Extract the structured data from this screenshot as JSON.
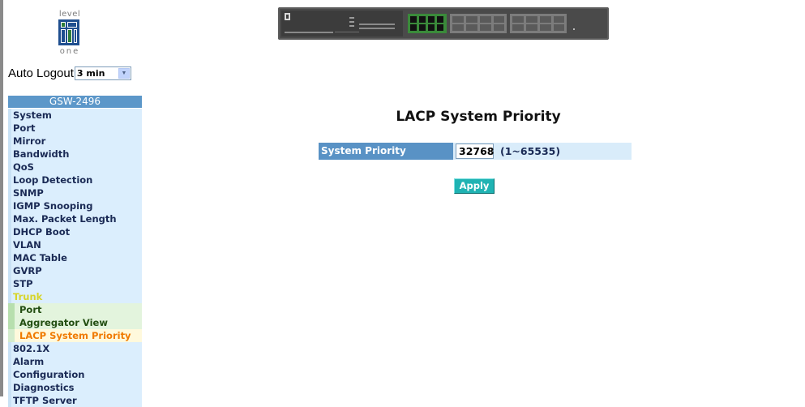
{
  "logo": {
    "top_text": "level",
    "bottom_text": "one"
  },
  "auto_logout": {
    "label": "Auto Logout",
    "selected": "3 min"
  },
  "sidebar": {
    "title": "GSW-2496",
    "items": [
      {
        "label": "System"
      },
      {
        "label": "Port"
      },
      {
        "label": "Mirror"
      },
      {
        "label": "Bandwidth"
      },
      {
        "label": "QoS"
      },
      {
        "label": "Loop Detection"
      },
      {
        "label": "SNMP"
      },
      {
        "label": "IGMP Snooping"
      },
      {
        "label": "Max. Packet Length"
      },
      {
        "label": "DHCP Boot"
      },
      {
        "label": "VLAN"
      },
      {
        "label": "MAC Table"
      },
      {
        "label": "GVRP"
      },
      {
        "label": "STP"
      },
      {
        "label": "Trunk",
        "state": "expanded"
      },
      {
        "label": "Port",
        "sub": true
      },
      {
        "label": "Aggregator View",
        "sub": true
      },
      {
        "label": "LACP System Priority",
        "sub": true,
        "state": "current"
      },
      {
        "label": "802.1X"
      },
      {
        "label": "Alarm"
      },
      {
        "label": "Configuration"
      },
      {
        "label": "Diagnostics"
      },
      {
        "label": "TFTP Server"
      }
    ]
  },
  "main": {
    "title": "LACP System Priority",
    "system_priority": {
      "label": "System Priority",
      "value": "32768",
      "range": "(1~65535)"
    },
    "apply_label": "Apply"
  },
  "colors": {
    "menu_bg": "#dbeefd",
    "header_blue": "#5c97c9",
    "apply_teal": "#1fb3b3",
    "current_orange": "#f07a00",
    "trunk_yellow": "#d7d52b"
  }
}
